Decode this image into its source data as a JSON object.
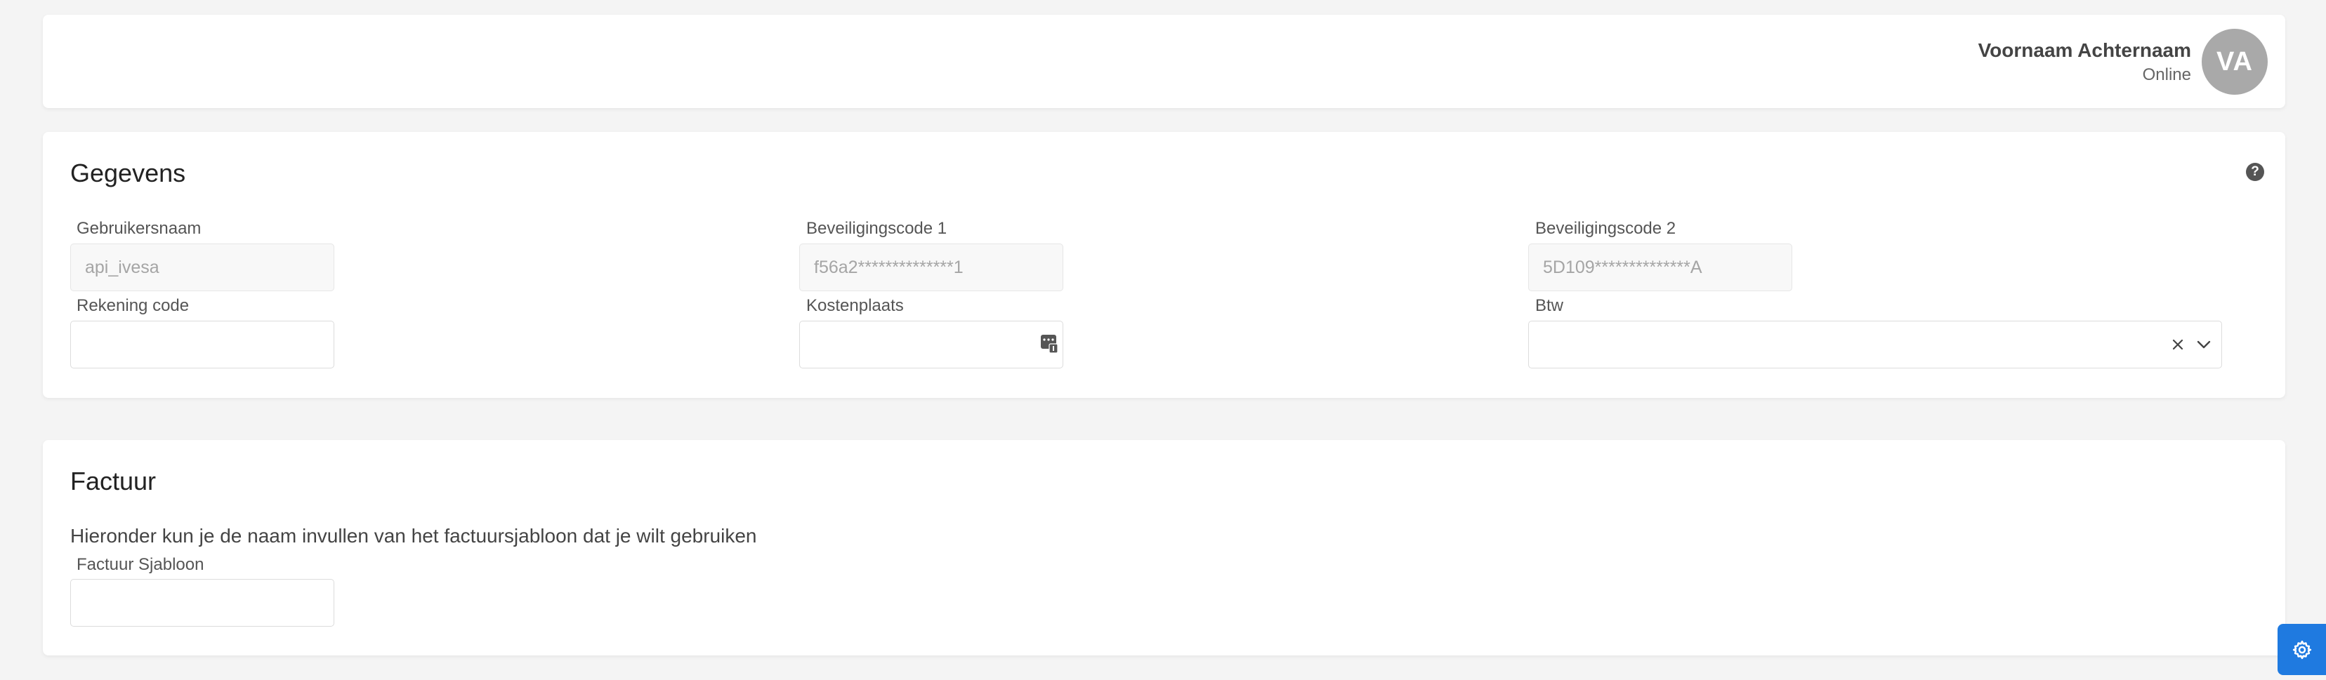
{
  "header": {
    "user_name": "Voornaam Achternaam",
    "user_status": "Online",
    "avatar_initials": "VA"
  },
  "gegevens": {
    "title": "Gegevens",
    "help_icon": "question-circle-icon",
    "fields": {
      "gebruikersnaam": {
        "label": "Gebruikersnaam",
        "value": "api_ivesa"
      },
      "beveiligingscode1": {
        "label": "Beveiligingscode 1",
        "value": "f56a2**************1"
      },
      "beveiligingscode2": {
        "label": "Beveiligingscode 2",
        "value": "5D109**************A"
      },
      "rekening_code": {
        "label": "Rekening code",
        "value": ""
      },
      "kostenplaats": {
        "label": "Kostenplaats",
        "value": ""
      },
      "btw": {
        "label": "Btw",
        "value": ""
      }
    }
  },
  "factuur": {
    "title": "Factuur",
    "description": "Hieronder kun je de naam invullen van het factuursjabloon dat je wilt gebruiken",
    "fields": {
      "sjabloon": {
        "label": "Factuur Sjabloon",
        "value": ""
      }
    }
  },
  "settings_button": {
    "icon": "gear-icon",
    "color": "#1f7ae0"
  }
}
